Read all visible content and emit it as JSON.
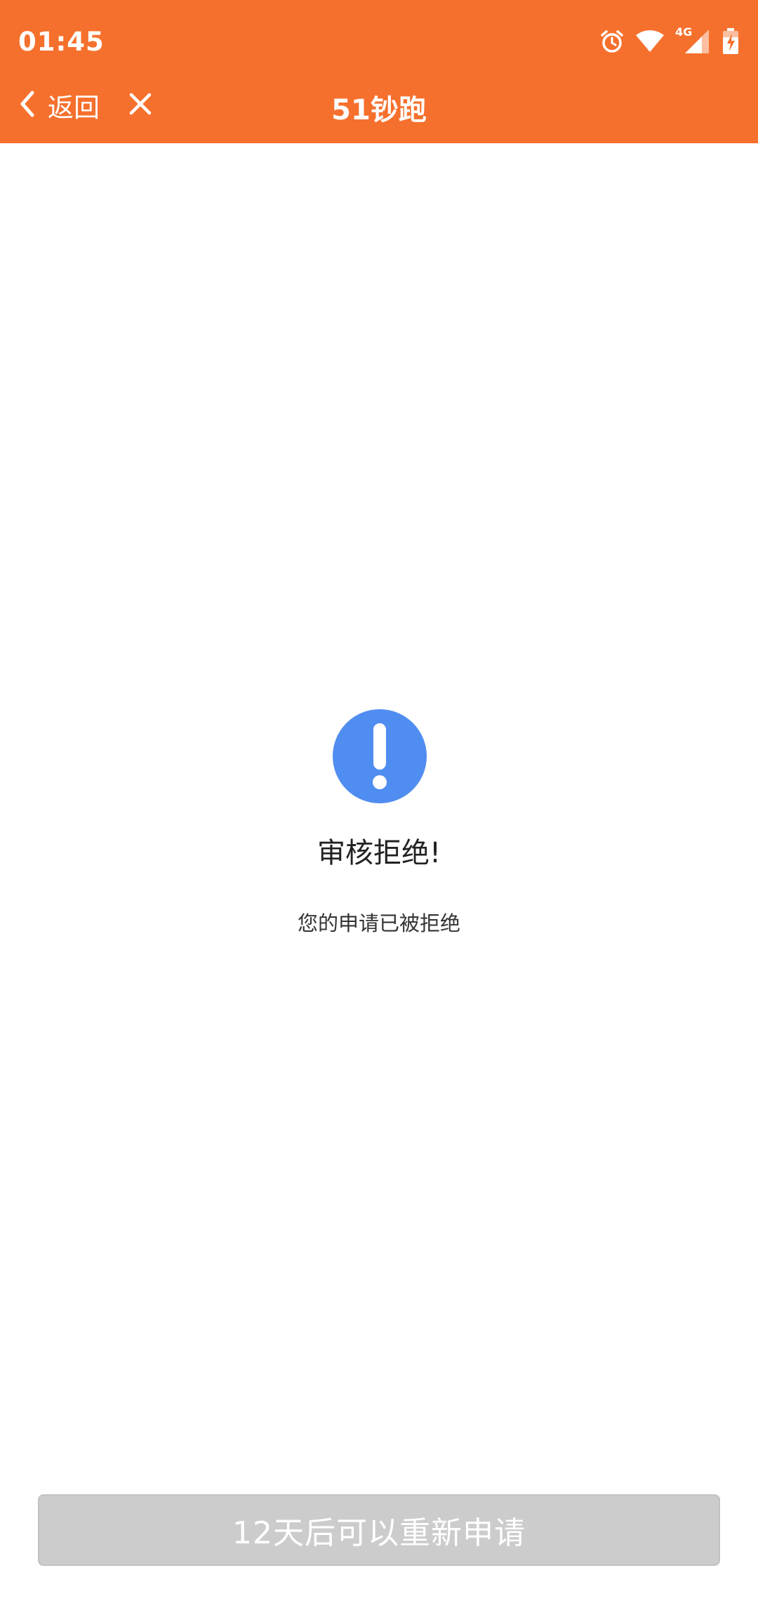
{
  "status_bar": {
    "time": "01:45",
    "network_label": "4G",
    "icons": [
      "alarm-icon",
      "wifi-icon",
      "signal-icon",
      "battery-charging-icon"
    ]
  },
  "app_bar": {
    "back_label": "返回",
    "title": "51钞跑",
    "back_icon": "chevron-left-icon",
    "close_icon": "close-icon"
  },
  "result": {
    "icon": "exclamation-circle-icon",
    "title": "审核拒绝!",
    "description": "您的申请已被拒绝"
  },
  "footer": {
    "reapply_label": "12天后可以重新申请"
  },
  "colors": {
    "header_bg": "#f6702d",
    "icon_blue": "#508df0",
    "button_disabled": "#cccccc"
  }
}
